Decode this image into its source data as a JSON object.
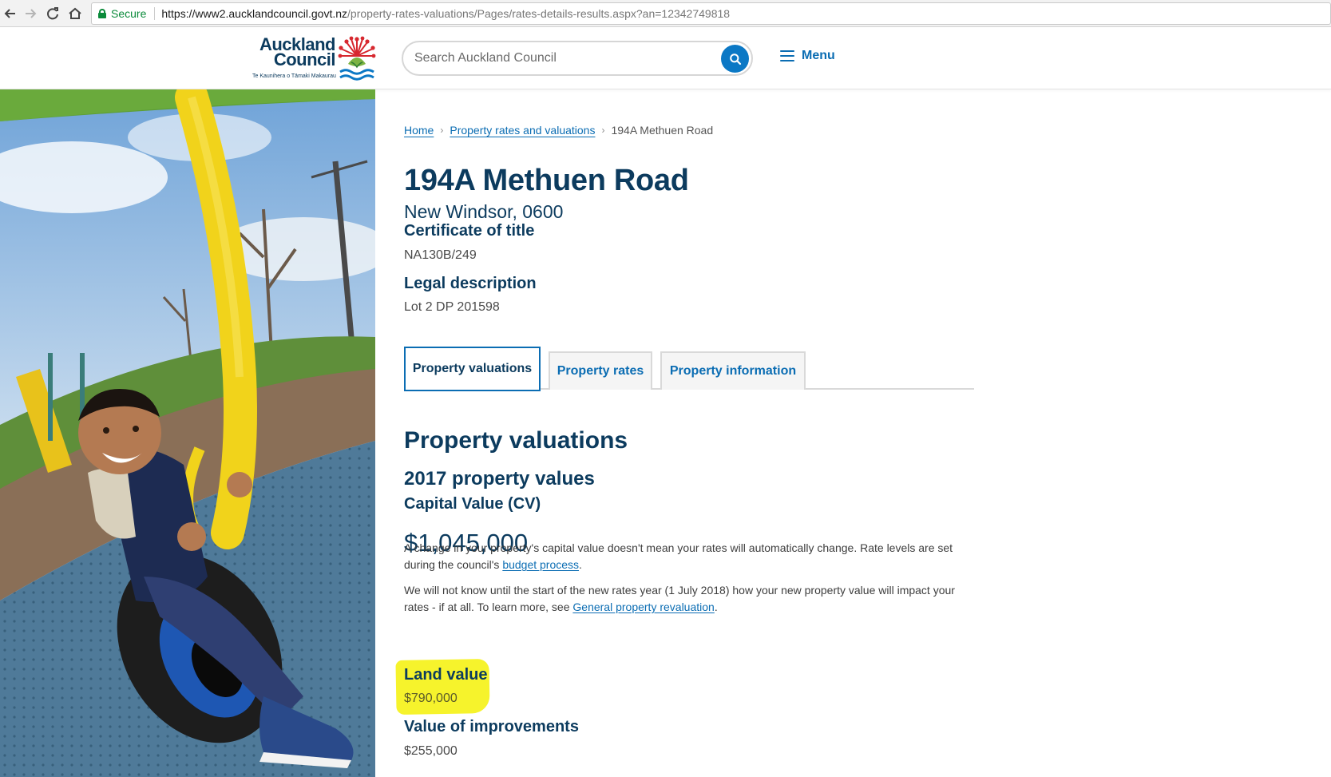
{
  "browser": {
    "secure_label": "Secure",
    "url_host": "https://www2.aucklandcouncil.govt.nz",
    "url_path": "/property-rates-valuations/Pages/rates-details-results.aspx?an=12342749818"
  },
  "header": {
    "logo_line1": "Auckland",
    "logo_line2": "Council",
    "logo_tagline": "Te Kaunihera o Tāmaki Makaurau",
    "search_placeholder": "Search Auckland Council",
    "menu_label": "Menu"
  },
  "breadcrumb": {
    "home": "Home",
    "section": "Property rates and valuations",
    "current": "194A Methuen Road"
  },
  "property": {
    "title": "194A Methuen Road",
    "suburb": "New Windsor, 0600",
    "certificate_label": "Certificate of title",
    "certificate_value": "NA130B/249",
    "legal_label": "Legal description",
    "legal_value": "Lot 2 DP 201598"
  },
  "tabs": [
    {
      "label": "Property valuations",
      "active": true
    },
    {
      "label": "Property rates",
      "active": false
    },
    {
      "label": "Property information",
      "active": false
    }
  ],
  "valuations": {
    "heading": "Property valuations",
    "subheading": "2017 property values",
    "cv_label": "Capital Value (CV)",
    "cv_amount": "$1,045,000",
    "para1_text": "A change in your property's capital value doesn't mean your rates will automatically change. Rate levels are set during the council's ",
    "para1_link": "budget process",
    "para1_end": ".",
    "para2_text": "We will not know until the start of the new rates year (1 July 2018) how your new property value will impact your rates - if at all. To learn more, see ",
    "para2_link": "General property revaluation",
    "para2_end": ".",
    "land_label": "Land value",
    "land_value": "$790,000",
    "improvements_label": "Value of improvements",
    "improvements_value": "$255,000"
  },
  "colors": {
    "brand_navy": "#0c3b5e",
    "link_blue": "#0b6db3",
    "search_button": "#0b78c5",
    "highlight_yellow": "#f5f21a",
    "secure_green": "#0a8a3a"
  }
}
